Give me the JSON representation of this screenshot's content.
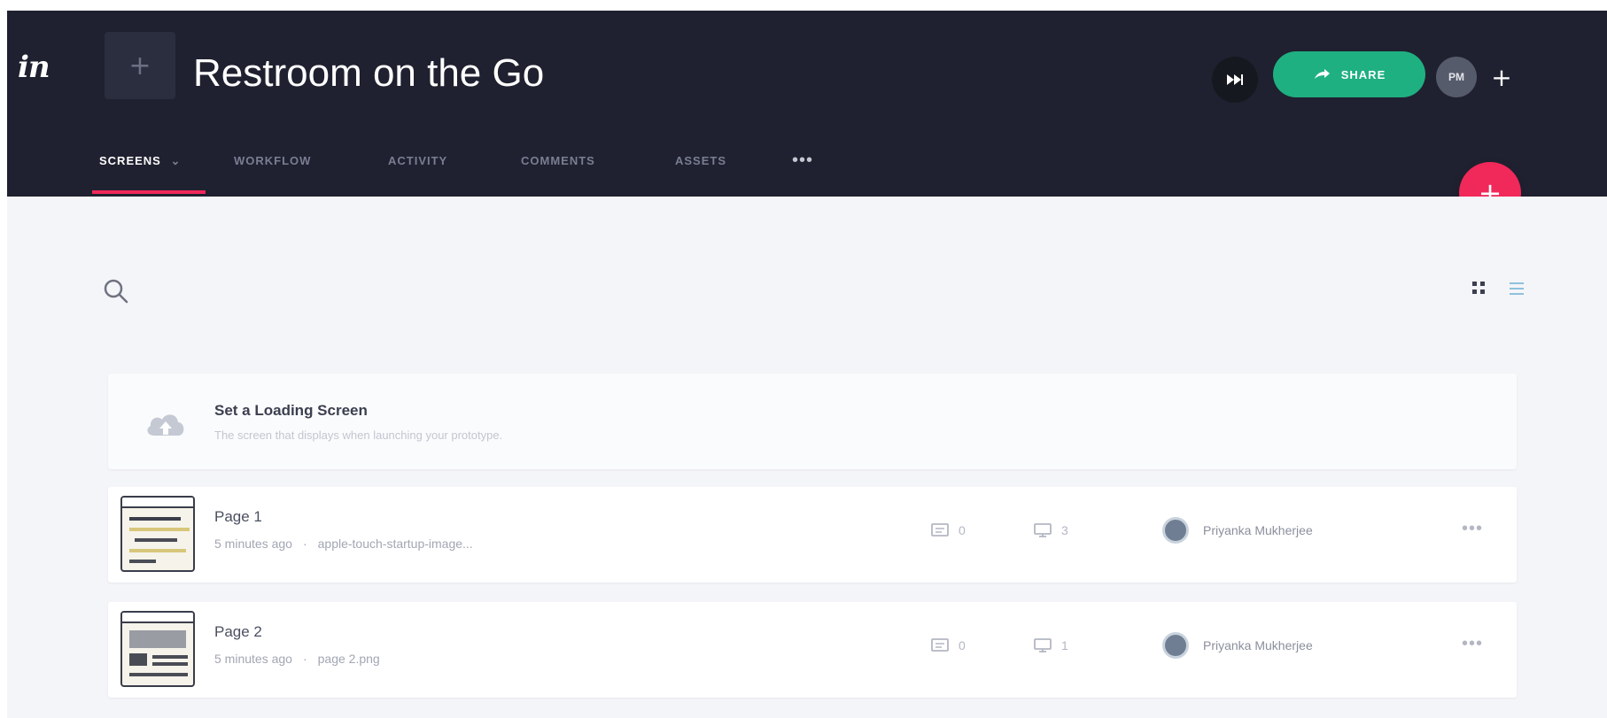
{
  "app": {
    "logo_text": "in",
    "project_title": "Restroom on the Go",
    "share_label": "SHARE",
    "user_initials": "PM",
    "add_collaborator_label": "+"
  },
  "tabs": [
    {
      "label": "SCREENS",
      "active": true
    },
    {
      "label": "WORKFLOW",
      "active": false
    },
    {
      "label": "ACTIVITY",
      "active": false
    },
    {
      "label": "COMMENTS",
      "active": false
    },
    {
      "label": "ASSETS",
      "active": false
    },
    {
      "label": "•••",
      "active": false
    }
  ],
  "fab_label": "+",
  "loading_screen": {
    "title": "Set a Loading Screen",
    "subtitle": "The screen that displays when launching your prototype."
  },
  "screens": [
    {
      "name": "Page 1",
      "time": "5 minutes ago",
      "file": "apple-touch-startup-image...",
      "comments": "0",
      "views": "3",
      "owner": "Priyanka Mukherjee",
      "more": "•••"
    },
    {
      "name": "Page 2",
      "time": "5 minutes ago",
      "file": "page 2.png",
      "comments": "0",
      "views": "1",
      "owner": "Priyanka Mukherjee",
      "more": "•••"
    }
  ],
  "colors": {
    "header_bg": "#1f2130",
    "accent_pink": "#f1285a",
    "share_green": "#1fb081",
    "body_bg": "#f4f5f8"
  },
  "icons": [
    "search-icon",
    "grid-view-icon",
    "list-view-icon",
    "cloud-upload-icon",
    "comment-icon",
    "monitor-icon",
    "fast-forward-icon",
    "share-arrow-icon"
  ]
}
